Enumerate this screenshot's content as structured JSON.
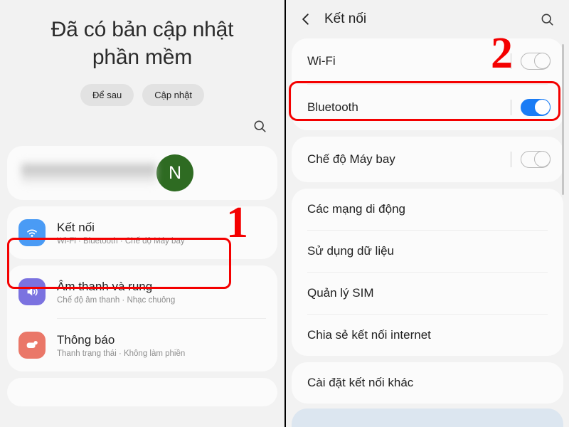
{
  "left_panel": {
    "update_notice": {
      "title": "Đã có bản cập nhật\nphần mềm",
      "title_line1": "Đã có bản cập nhật",
      "title_line2": "phần mềm",
      "later_button": "Để sau",
      "update_button": "Cập nhật"
    },
    "search_icon": "search-icon",
    "account": {
      "name_redacted": "",
      "avatar_initial": "N",
      "avatar_color": "#2e6b22"
    },
    "settings_items": [
      {
        "title": "Kết nối",
        "subtitle": "Wi-Fi  ·  Bluetooth  ·  Chế độ Máy bay",
        "icon": "wifi-icon",
        "icon_color": "#4a9bf5",
        "highlighted": true
      },
      {
        "title": "Âm thanh và rung",
        "subtitle": "Chế độ âm thanh  ·  Nhạc chuông",
        "icon": "speaker-icon",
        "icon_color": "#7b72e0",
        "highlighted": false
      },
      {
        "title": "Thông báo",
        "subtitle": "Thanh trạng thái  ·  Không làm phiền",
        "icon": "notification-icon",
        "icon_color": "#ea7768",
        "highlighted": false
      }
    ],
    "step_marker": "1"
  },
  "right_panel": {
    "header": {
      "back_icon": "back-chevron-icon",
      "title": "Kết nối",
      "search_icon": "search-icon"
    },
    "toggles": [
      {
        "label": "Wi-Fi",
        "state": "off",
        "highlighted": false
      },
      {
        "label": "Bluetooth",
        "state": "on",
        "highlighted": true
      },
      {
        "label": "Chế độ Máy bay",
        "state": "off",
        "highlighted": false
      }
    ],
    "links_group_1": [
      "Các mạng di động",
      "Sử dụng dữ liệu",
      "Quản lý SIM",
      "Chia sẻ kết nối internet"
    ],
    "links_group_2": [
      "Cài đặt kết nối khác"
    ],
    "step_marker": "2"
  },
  "colors": {
    "highlight_red": "#f40000",
    "toggle_on_blue": "#1a7cf5",
    "panel_background": "#f2f2f2",
    "card_background": "#fbfbfb"
  }
}
